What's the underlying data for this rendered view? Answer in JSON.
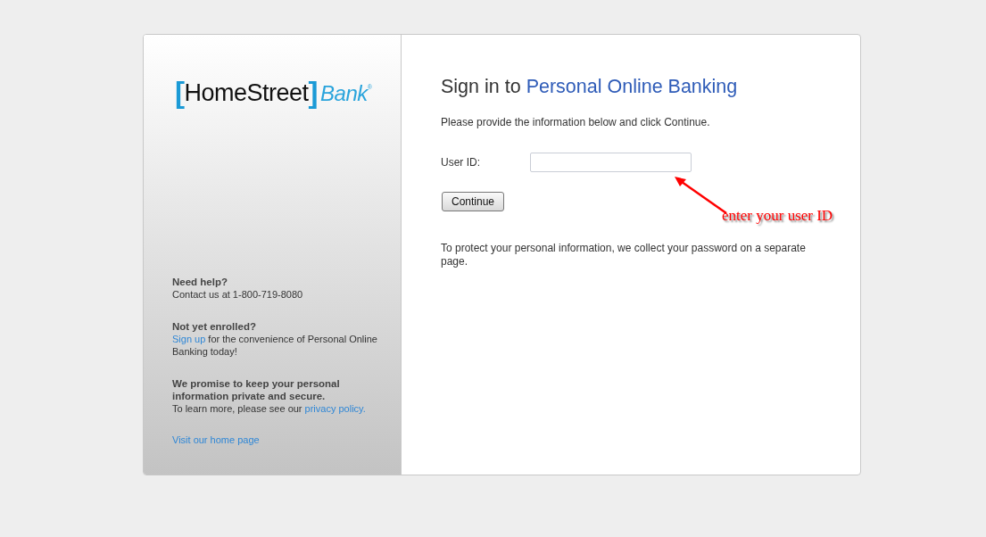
{
  "logo": {
    "bracket_left": "[",
    "name": "HomeStreet",
    "bracket_right": "]",
    "suffix": "Bank",
    "mark": "®"
  },
  "sidebar": {
    "sections": [
      {
        "title": "Need help?",
        "parts": [
          {
            "text": "Contact us at 1-800-719-8080",
            "link": false
          }
        ]
      },
      {
        "title": "Not yet enrolled?",
        "parts": [
          {
            "text": "Sign up",
            "link": true
          },
          {
            "text": " for the convenience of Personal Online Banking today!",
            "link": false
          }
        ]
      },
      {
        "title": "We promise to keep your personal information private and secure.",
        "parts": [
          {
            "text": "To learn more, please see our ",
            "link": false
          },
          {
            "text": "privacy policy.",
            "link": true
          }
        ]
      },
      {
        "parts": [
          {
            "text": "Visit our home page",
            "link": true
          }
        ]
      }
    ]
  },
  "heading": {
    "prefix": "Sign in to ",
    "highlight": "Personal Online Banking"
  },
  "instructions": "Please provide the information below and click Continue.",
  "user_id": {
    "label": "User ID:"
  },
  "continue_button": "Continue",
  "note": "To protect your personal information, we collect your password on a separate page.",
  "annotation": {
    "text": "enter your user ID"
  }
}
